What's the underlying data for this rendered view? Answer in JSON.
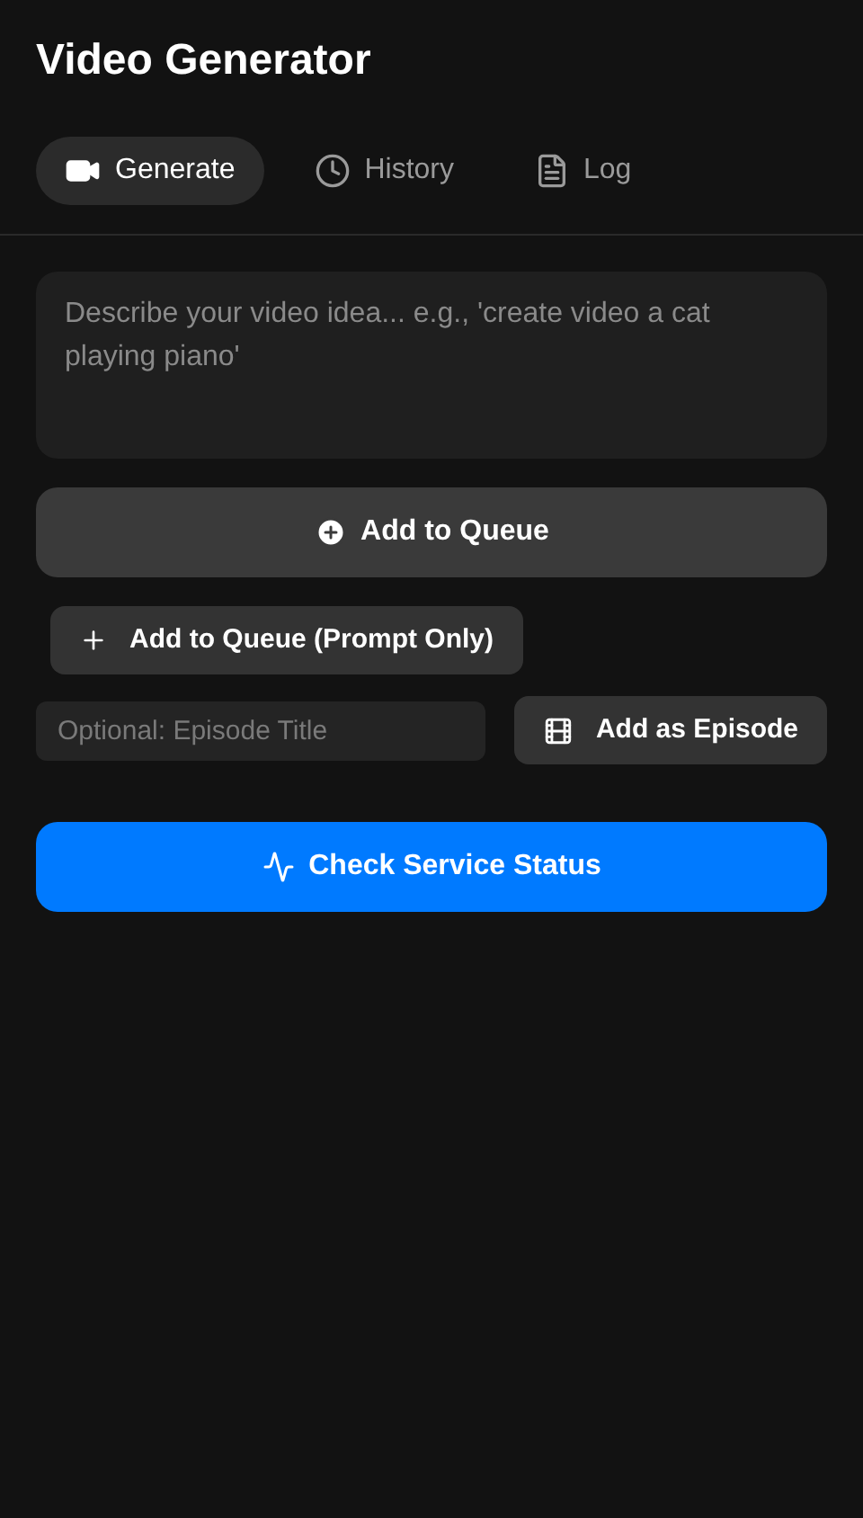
{
  "title": "Video Generator",
  "tabs": [
    {
      "label": "Generate",
      "kind": "video",
      "selected": true
    },
    {
      "label": "History",
      "kind": "clock",
      "selected": false
    },
    {
      "label": "Log",
      "kind": "file",
      "selected": false
    }
  ],
  "prompt": {
    "placeholder": "Describe your video idea... e.g., 'create video a cat playing piano'"
  },
  "add_button": "Add to Queue",
  "prompt_only_button": "Add to Queue (Prompt Only)",
  "episode_field": {
    "placeholder": "Optional: Episode Title"
  },
  "episode_button": "Add as Episode",
  "status_button": "Check Service Status"
}
